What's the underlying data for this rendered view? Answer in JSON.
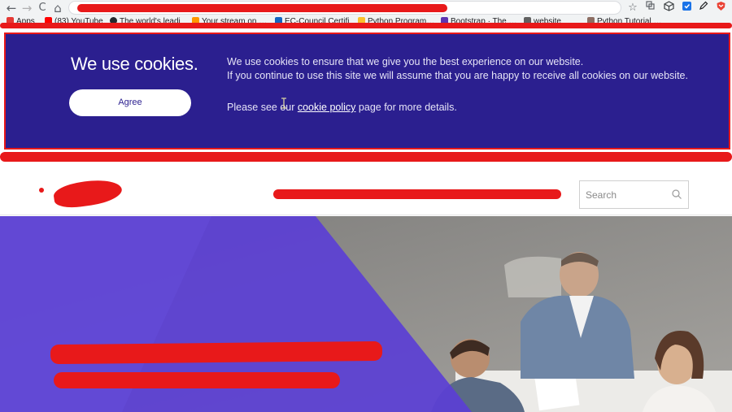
{
  "browser": {
    "nav": {
      "back": "←",
      "forward": "→",
      "reload": "C",
      "home": "⌂"
    },
    "bookmarks": [
      {
        "label": "Apps",
        "color": "#e53935"
      },
      {
        "label": "(83) YouTube",
        "color": "#ff0000"
      },
      {
        "label": "The world's leadi",
        "color": "#24292e"
      },
      {
        "label": "Your stream on …",
        "color": "#ff9800"
      },
      {
        "label": "EC-Council Certifi",
        "color": "#1565c0"
      },
      {
        "label": "Python Program…",
        "color": "#fbc02d"
      },
      {
        "label": "Bootstrap · The …",
        "color": "#5e35b1"
      },
      {
        "label": "website",
        "color": "#616161"
      },
      {
        "label": "Python Tutorial …",
        "color": "#8d6e63"
      }
    ],
    "icons": [
      "star-icon",
      "extension-icon",
      "cube-icon",
      "shield-icon",
      "pen-icon",
      "mail-icon"
    ],
    "accent_redaction": "#e8191a"
  },
  "cookie_banner": {
    "title": "We use cookies.",
    "agree_label": "Agree",
    "line1": "We use cookies to ensure that we give you the best experience on our website.",
    "line2": "If you continue to use this site we will assume that you are happy to receive all cookies on our website.",
    "line3_prefix": "Please see our ",
    "link": "cookie policy",
    "line3_suffix": " page for more details.",
    "background": "#2b1f8f"
  },
  "header": {
    "search_placeholder": "Search"
  },
  "hero": {
    "overlay_color": "#5b3fd4"
  }
}
